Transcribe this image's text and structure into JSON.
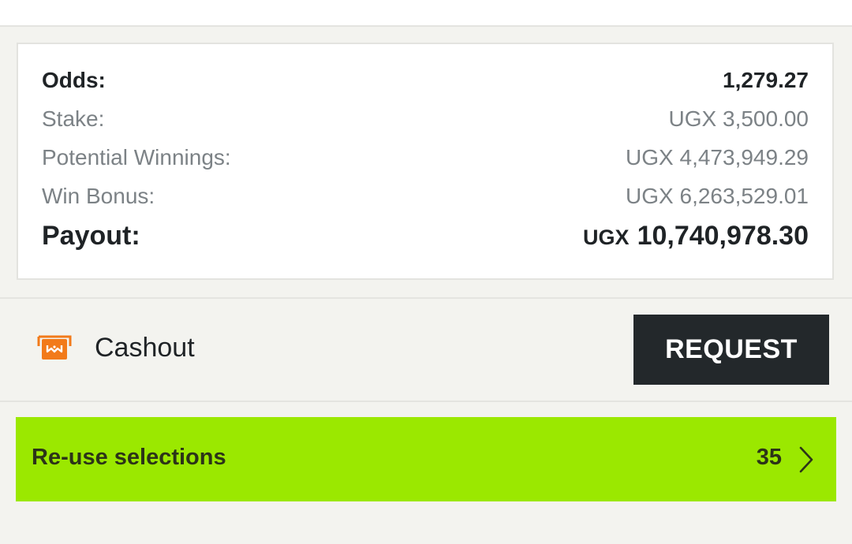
{
  "summary": {
    "odds": {
      "label": "Odds:",
      "value": "1,279.27"
    },
    "stake": {
      "label": "Stake:",
      "value": "UGX 3,500.00"
    },
    "potential_winnings": {
      "label": "Potential Winnings:",
      "value": "UGX 4,473,949.29"
    },
    "win_bonus": {
      "label": "Win Bonus:",
      "value": "UGX 6,263,529.01"
    },
    "payout": {
      "label": "Payout:",
      "currency": "UGX",
      "amount": "10,740,978.30"
    }
  },
  "cashout": {
    "icon": "cashout-icon",
    "label": "Cashout",
    "button_label": "REQUEST"
  },
  "reuse": {
    "label": "Re-use selections",
    "count": "35",
    "icon": "chevron-right-icon"
  },
  "colors": {
    "accent_green": "#9be800",
    "dark_button": "#23282b",
    "cashout_orange": "#f27a1a",
    "background": "#f3f3ef"
  }
}
